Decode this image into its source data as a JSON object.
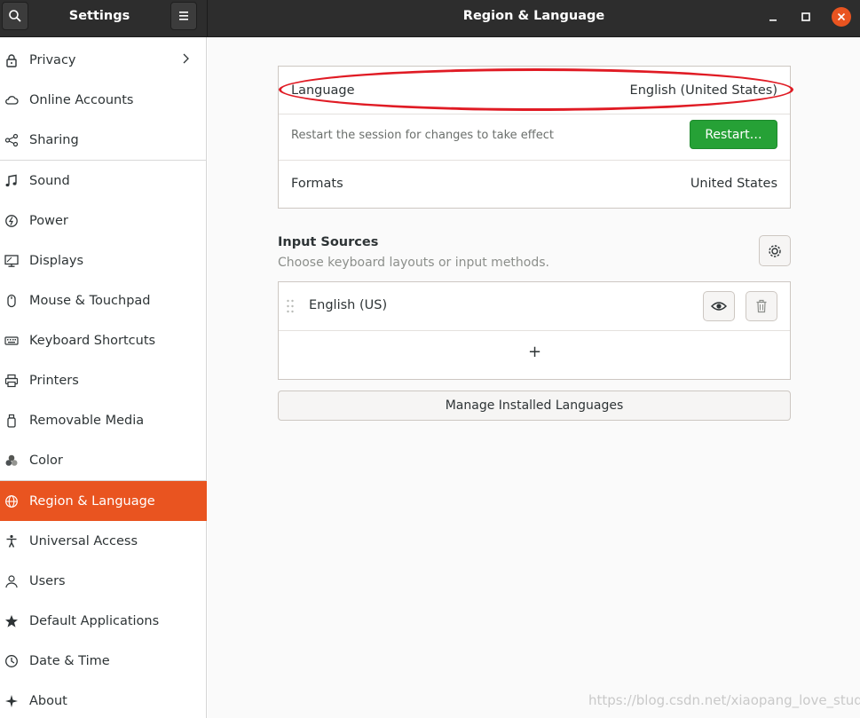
{
  "header": {
    "sidebar_title": "Settings",
    "title": "Region & Language"
  },
  "sidebar": {
    "items": [
      {
        "label": "Privacy",
        "icon": "lock-icon"
      },
      {
        "label": "Online Accounts",
        "icon": "cloud-icon"
      },
      {
        "label": "Sharing",
        "icon": "share-icon"
      },
      {
        "label": "Sound",
        "icon": "music-note-icon"
      },
      {
        "label": "Power",
        "icon": "power-icon"
      },
      {
        "label": "Displays",
        "icon": "display-icon"
      },
      {
        "label": "Mouse & Touchpad",
        "icon": "mouse-icon"
      },
      {
        "label": "Keyboard Shortcuts",
        "icon": "keyboard-icon"
      },
      {
        "label": "Printers",
        "icon": "printer-icon"
      },
      {
        "label": "Removable Media",
        "icon": "usb-drive-icon"
      },
      {
        "label": "Color",
        "icon": "color-icon"
      },
      {
        "label": "Region & Language",
        "icon": "globe-icon",
        "active": true
      },
      {
        "label": "Universal Access",
        "icon": "accessibility-icon"
      },
      {
        "label": "Users",
        "icon": "users-icon"
      },
      {
        "label": "Default Applications",
        "icon": "star-icon"
      },
      {
        "label": "Date & Time",
        "icon": "clock-icon"
      },
      {
        "label": "About",
        "icon": "about-icon"
      }
    ]
  },
  "language_section": {
    "language_label": "Language",
    "language_value": "English (United States)",
    "restart_note": "Restart the session for changes to take effect",
    "restart_button": "Restart…",
    "formats_label": "Formats",
    "formats_value": "United States"
  },
  "input_sources": {
    "title": "Input Sources",
    "subtitle": "Choose keyboard layouts or input methods.",
    "sources": [
      {
        "label": "English (US)"
      }
    ],
    "add_symbol": "+"
  },
  "manage_button": "Manage Installed Languages",
  "watermark": "https://blog.csdn.net/xiaopang_love_study",
  "colors": {
    "accent": "#e95420",
    "restart_green": "#26a136",
    "highlight_red": "#e01b24",
    "header_bg": "#2d2d2d"
  }
}
